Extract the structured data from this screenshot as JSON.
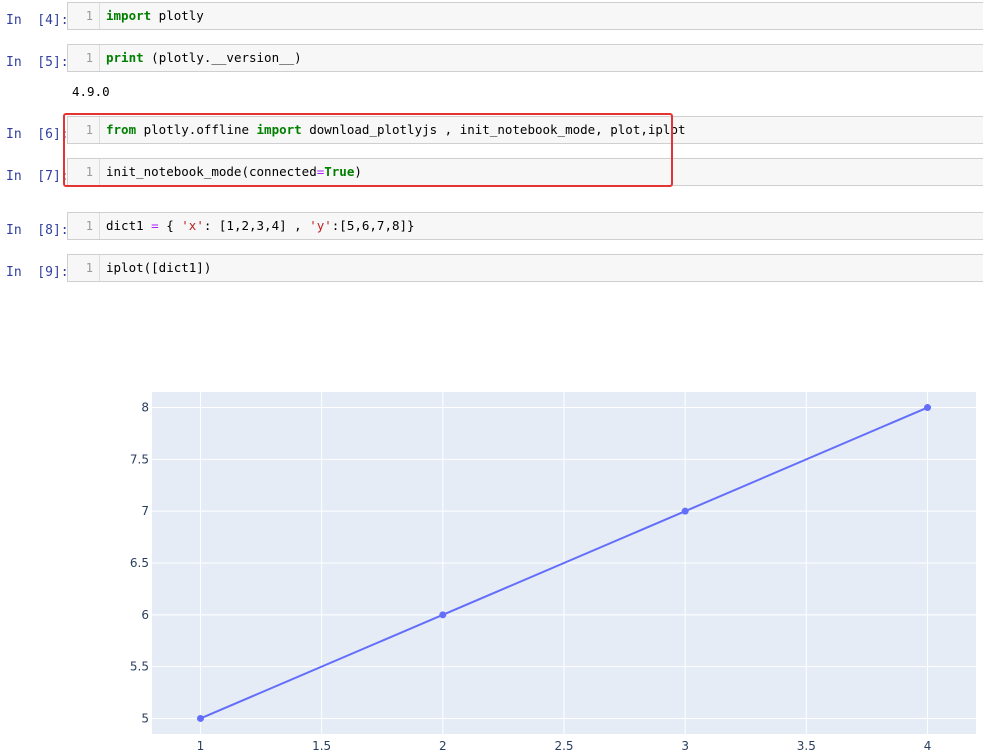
{
  "cells": [
    {
      "prompt": "In  [4]:",
      "line": "1",
      "tokens": [
        {
          "t": "import",
          "c": "kw"
        },
        {
          "t": " plotly",
          "c": ""
        }
      ]
    },
    {
      "prompt": "In  [5]:",
      "line": "1",
      "tokens": [
        {
          "t": "print",
          "c": "kw"
        },
        {
          "t": " (plotly.__version__)",
          "c": ""
        }
      ]
    },
    {
      "prompt": "In  [6]:",
      "line": "1",
      "tokens": [
        {
          "t": "from",
          "c": "kw"
        },
        {
          "t": " plotly.offline ",
          "c": ""
        },
        {
          "t": "import",
          "c": "kw"
        },
        {
          "t": " download_plotlyjs , init_notebook_mode, plot,iplot",
          "c": ""
        }
      ]
    },
    {
      "prompt": "In  [7]:",
      "line": "1",
      "tokens": [
        {
          "t": "init_notebook_mode(connected",
          "c": ""
        },
        {
          "t": "=",
          "c": "op"
        },
        {
          "t": "True",
          "c": "kw"
        },
        {
          "t": ")",
          "c": ""
        }
      ]
    },
    {
      "prompt": "In  [8]:",
      "line": "1",
      "tokens": [
        {
          "t": "dict1 ",
          "c": ""
        },
        {
          "t": "=",
          "c": "op"
        },
        {
          "t": " { ",
          "c": ""
        },
        {
          "t": "'x'",
          "c": "str"
        },
        {
          "t": ": [1,2,3,4] , ",
          "c": ""
        },
        {
          "t": "'y'",
          "c": "str"
        },
        {
          "t": ":[5,6,7,8]}",
          "c": ""
        }
      ]
    },
    {
      "prompt": "In  [9]:",
      "line": "1",
      "tokens": [
        {
          "t": "iplot([dict1])",
          "c": ""
        }
      ]
    }
  ],
  "output_5": "4.9.0",
  "colors": {
    "plot_bg": "#e5ecf6",
    "line": "#636efa",
    "highlight": "#e53333",
    "prompt": "#303f9f"
  },
  "chart_data": {
    "type": "line",
    "x": [
      1,
      2,
      3,
      4
    ],
    "series": [
      {
        "values": [
          5,
          6,
          7,
          8
        ]
      }
    ],
    "xlim": [
      0.8,
      4.2
    ],
    "ylim": [
      4.85,
      8.15
    ],
    "xticks": [
      1,
      1.5,
      2,
      2.5,
      3,
      3.5,
      4
    ],
    "xtick_labels": [
      "1",
      "1.5",
      "2",
      "2.5",
      "3",
      "3.5",
      "4"
    ],
    "yticks": [
      5,
      5.5,
      6,
      6.5,
      7,
      7.5,
      8
    ],
    "ytick_labels": [
      "5",
      "5.5",
      "6",
      "6.5",
      "7",
      "7.5",
      "8"
    ],
    "grid": true,
    "mode": "lines+markers"
  }
}
